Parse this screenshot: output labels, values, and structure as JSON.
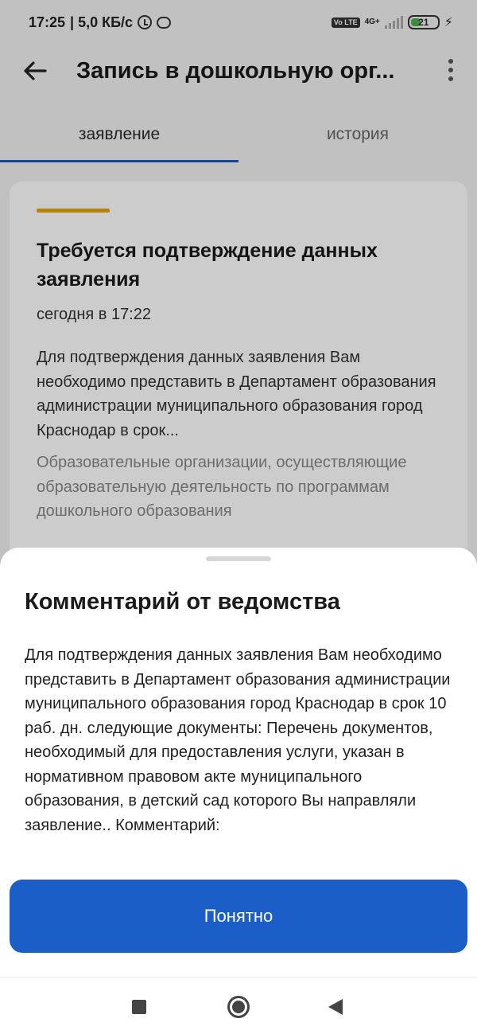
{
  "status_bar": {
    "time": "17:25",
    "speed": "| 5,0 КБ/с",
    "volte": "Vo LTE",
    "network": "4G+",
    "battery": "21",
    "icons": [
      "alarm-icon",
      "chat-icon",
      "volte-icon",
      "signal-icon",
      "battery-icon",
      "charging-icon"
    ]
  },
  "app_bar": {
    "title": "Запись в дошкольную орг...",
    "back_icon": "arrow-left-icon",
    "menu_icon": "more-vert-icon"
  },
  "tabs": [
    {
      "label": "заявление",
      "active": true
    },
    {
      "label": "история",
      "active": false
    }
  ],
  "card": {
    "accent_color": "#e2a400",
    "title": "Требуется подтверждение данных заявления",
    "date": "сегодня в 17:22",
    "body": "Для подтверждения данных заявления Вам необходимо представить в Департамент образования администрации муниципального образования город Краснодар в срок...",
    "organization": "Образовательные организации, осуществляющие образовательную деятельность по программам дошкольного образования"
  },
  "sheet": {
    "title": "Комментарий от ведомства",
    "text": "Для подтверждения данных заявления Вам необходимо представить в Департамент образования администрации муниципального образования город Краснодар в срок 10 раб. дн. следующие документы: Перечень документов, необходимый для предоставления услуги, указан в нормативном правовом акте муниципального образования, в детский сад которого Вы направляли заявление.. Комментарий:",
    "button_label": "Понятно",
    "button_color": "#1b5ec8"
  },
  "colors": {
    "accent": "#1b54c9",
    "background": "#f2f2f2"
  }
}
